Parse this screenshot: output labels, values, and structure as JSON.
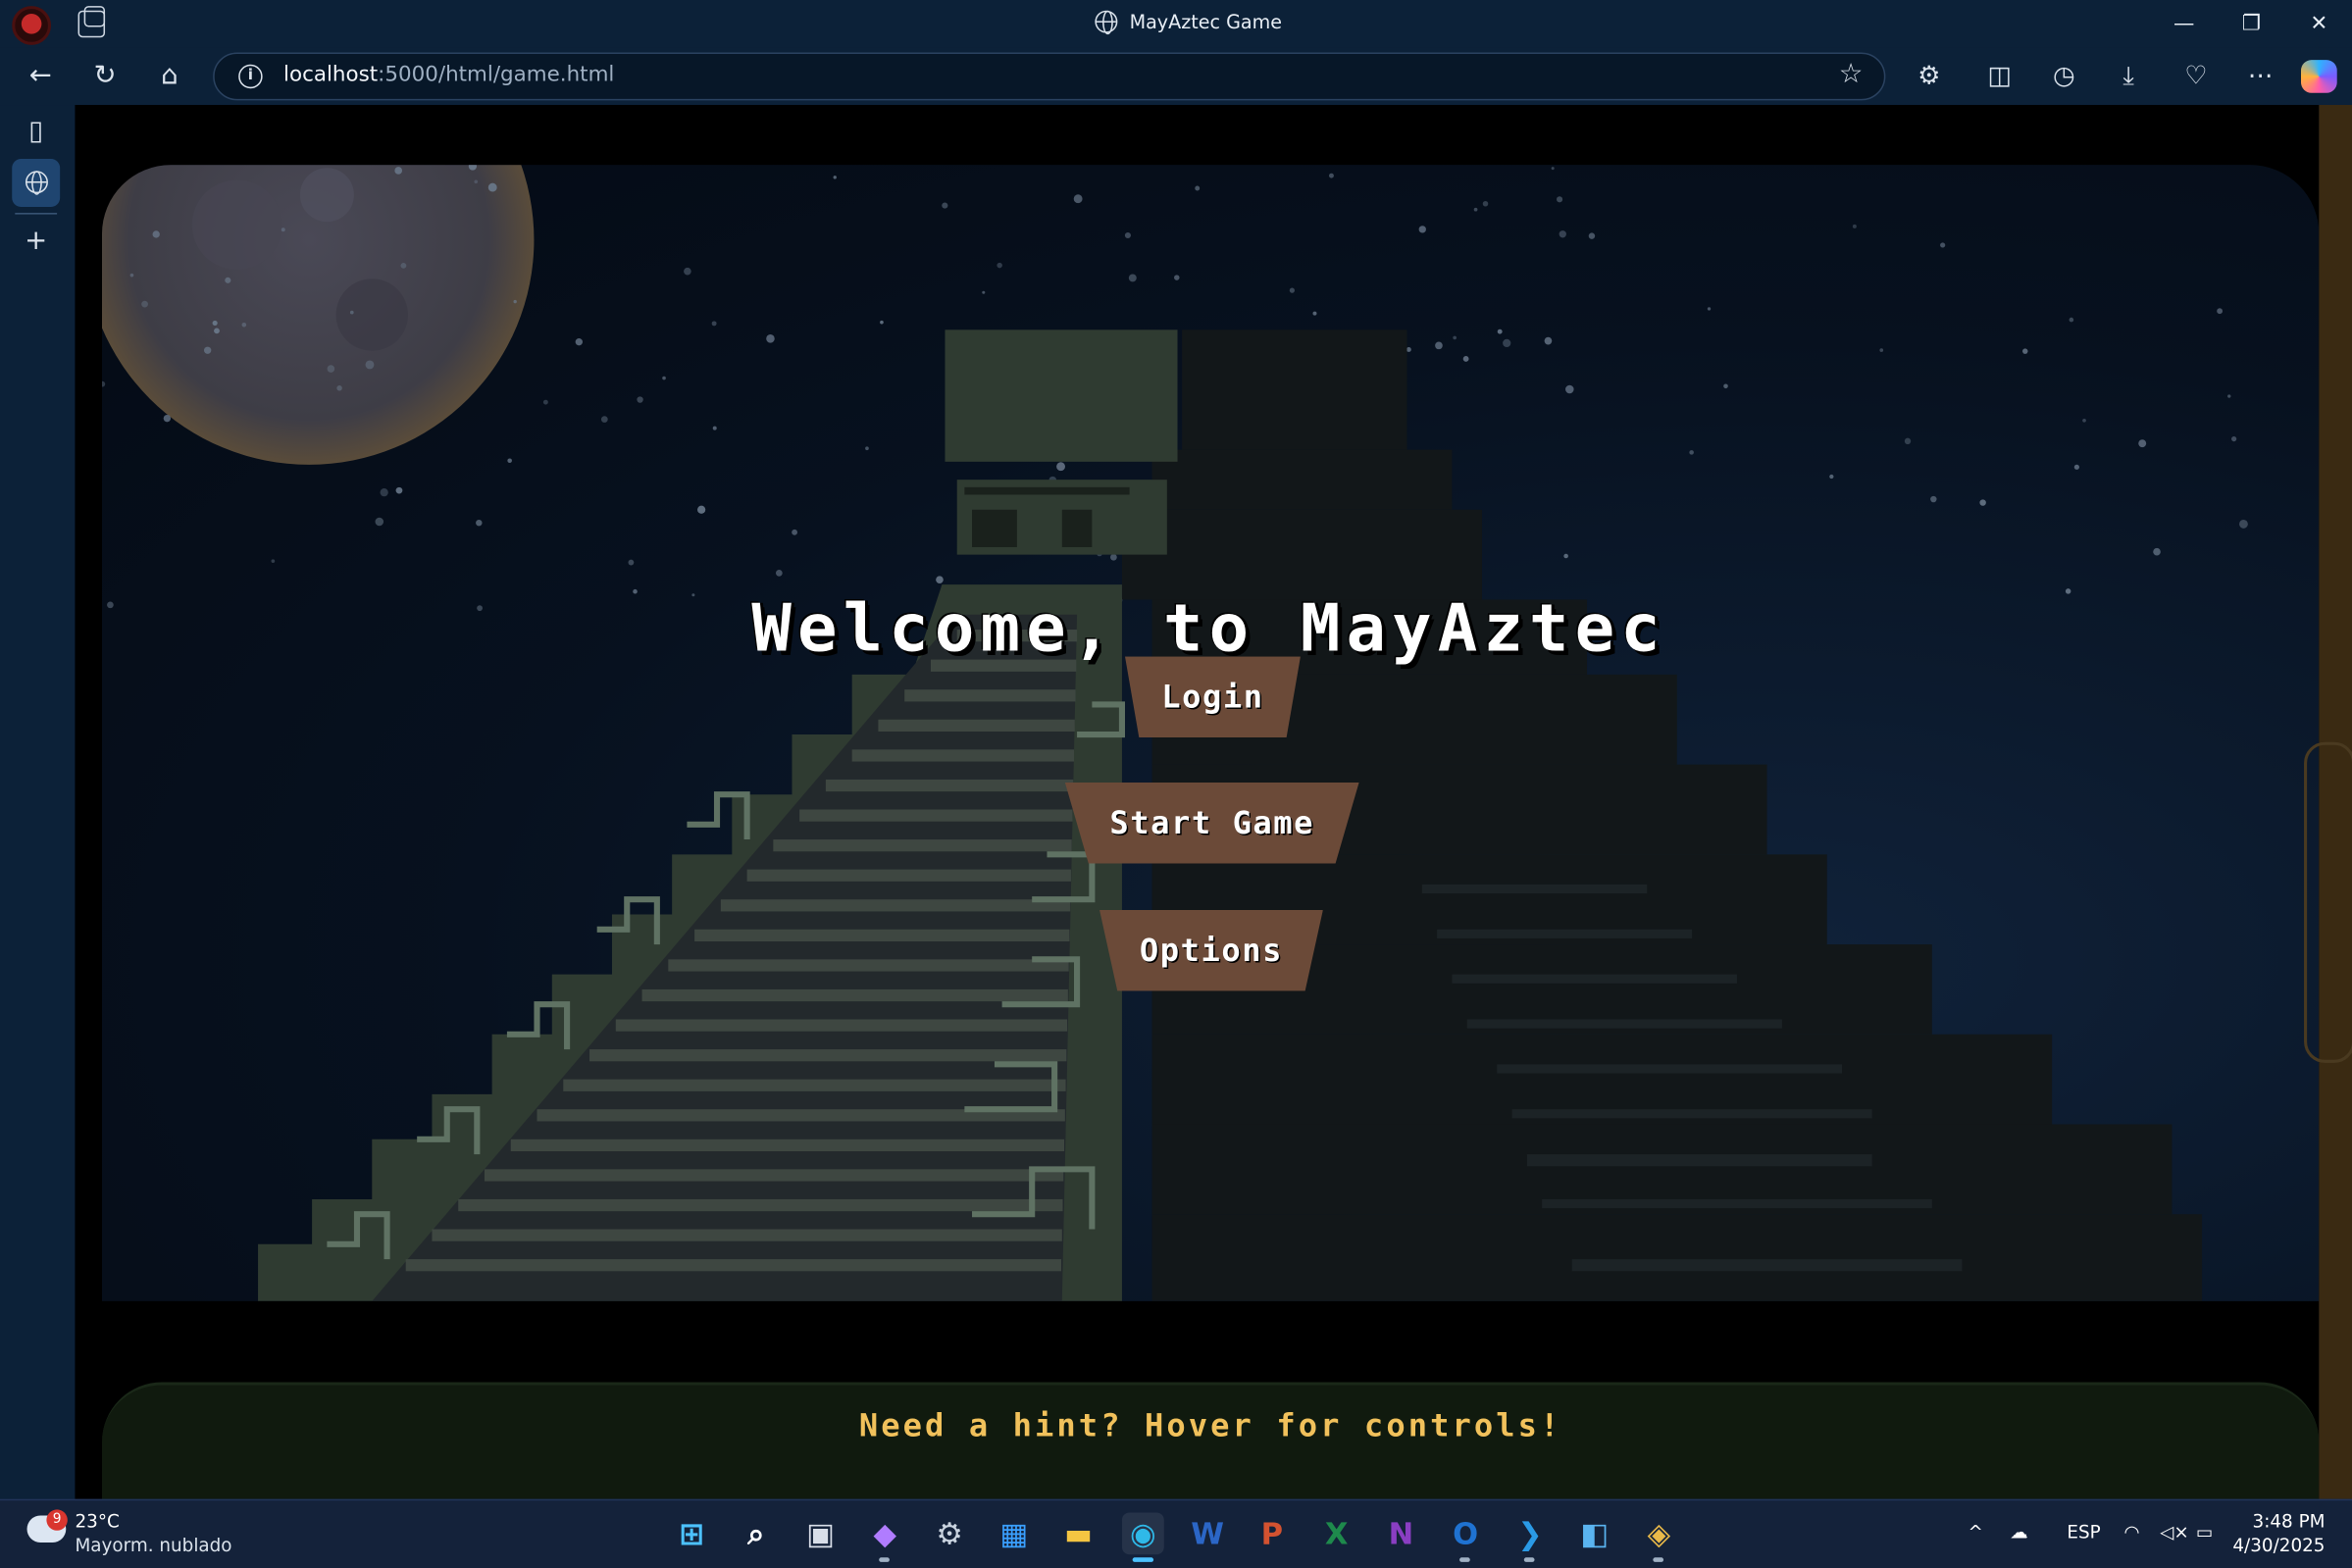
{
  "browser": {
    "tab_title": "MayAztec Game",
    "url_host": "localhost",
    "url_rest": ":5000/html/game.html"
  },
  "window_controls": {
    "minimize": "—",
    "restore": "❐",
    "close": "✕"
  },
  "game": {
    "welcome_title": "Welcome, to MayAztec",
    "buttons": {
      "login": "Login",
      "start": "Start Game",
      "options": "Options"
    },
    "hint": "Need a hint? Hover for controls!",
    "colors": {
      "button": "#6b4a38",
      "hint": "#f1c15b",
      "pyramid_lit": "#3a4a3c",
      "pyramid_shadow": "#141a1c",
      "sky": "#07111f"
    }
  },
  "taskbar": {
    "weather": {
      "badge": "9",
      "temp": "23°C",
      "desc": "Mayorm. nublado"
    },
    "apps": [
      {
        "name": "start-menu",
        "glyph": "⊞",
        "color": "#4cc2ff"
      },
      {
        "name": "search",
        "glyph": "⌕",
        "color": "#ffffff"
      },
      {
        "name": "task-view",
        "glyph": "▣",
        "color": "#d8dee8"
      },
      {
        "name": "copilot",
        "glyph": "◆",
        "color": "#b07cff"
      },
      {
        "name": "settings",
        "glyph": "⚙",
        "color": "#c9d3df"
      },
      {
        "name": "microsoft-store",
        "glyph": "▦",
        "color": "#3aa0ff"
      },
      {
        "name": "file-explorer",
        "glyph": "▬",
        "color": "#f4c542"
      },
      {
        "name": "edge",
        "glyph": "◉",
        "color": "#2fb9e8"
      },
      {
        "name": "word",
        "glyph": "W",
        "color": "#2b66c6"
      },
      {
        "name": "powerpoint",
        "glyph": "P",
        "color": "#d35230"
      },
      {
        "name": "excel",
        "glyph": "X",
        "color": "#1e8a4c"
      },
      {
        "name": "onenote",
        "glyph": "N",
        "color": "#8a3ec2"
      },
      {
        "name": "outlook",
        "glyph": "O",
        "color": "#1f72d1"
      },
      {
        "name": "vscode",
        "glyph": "❯",
        "color": "#2a9ae6"
      },
      {
        "name": "app-blue",
        "glyph": "◧",
        "color": "#5ab4f0"
      },
      {
        "name": "git-tool",
        "glyph": "◈",
        "color": "#e9b949"
      }
    ],
    "tray": {
      "lang": "ESP",
      "chevron": "^"
    },
    "clock": {
      "time": "3:48 PM",
      "date": "4/30/2025"
    }
  }
}
